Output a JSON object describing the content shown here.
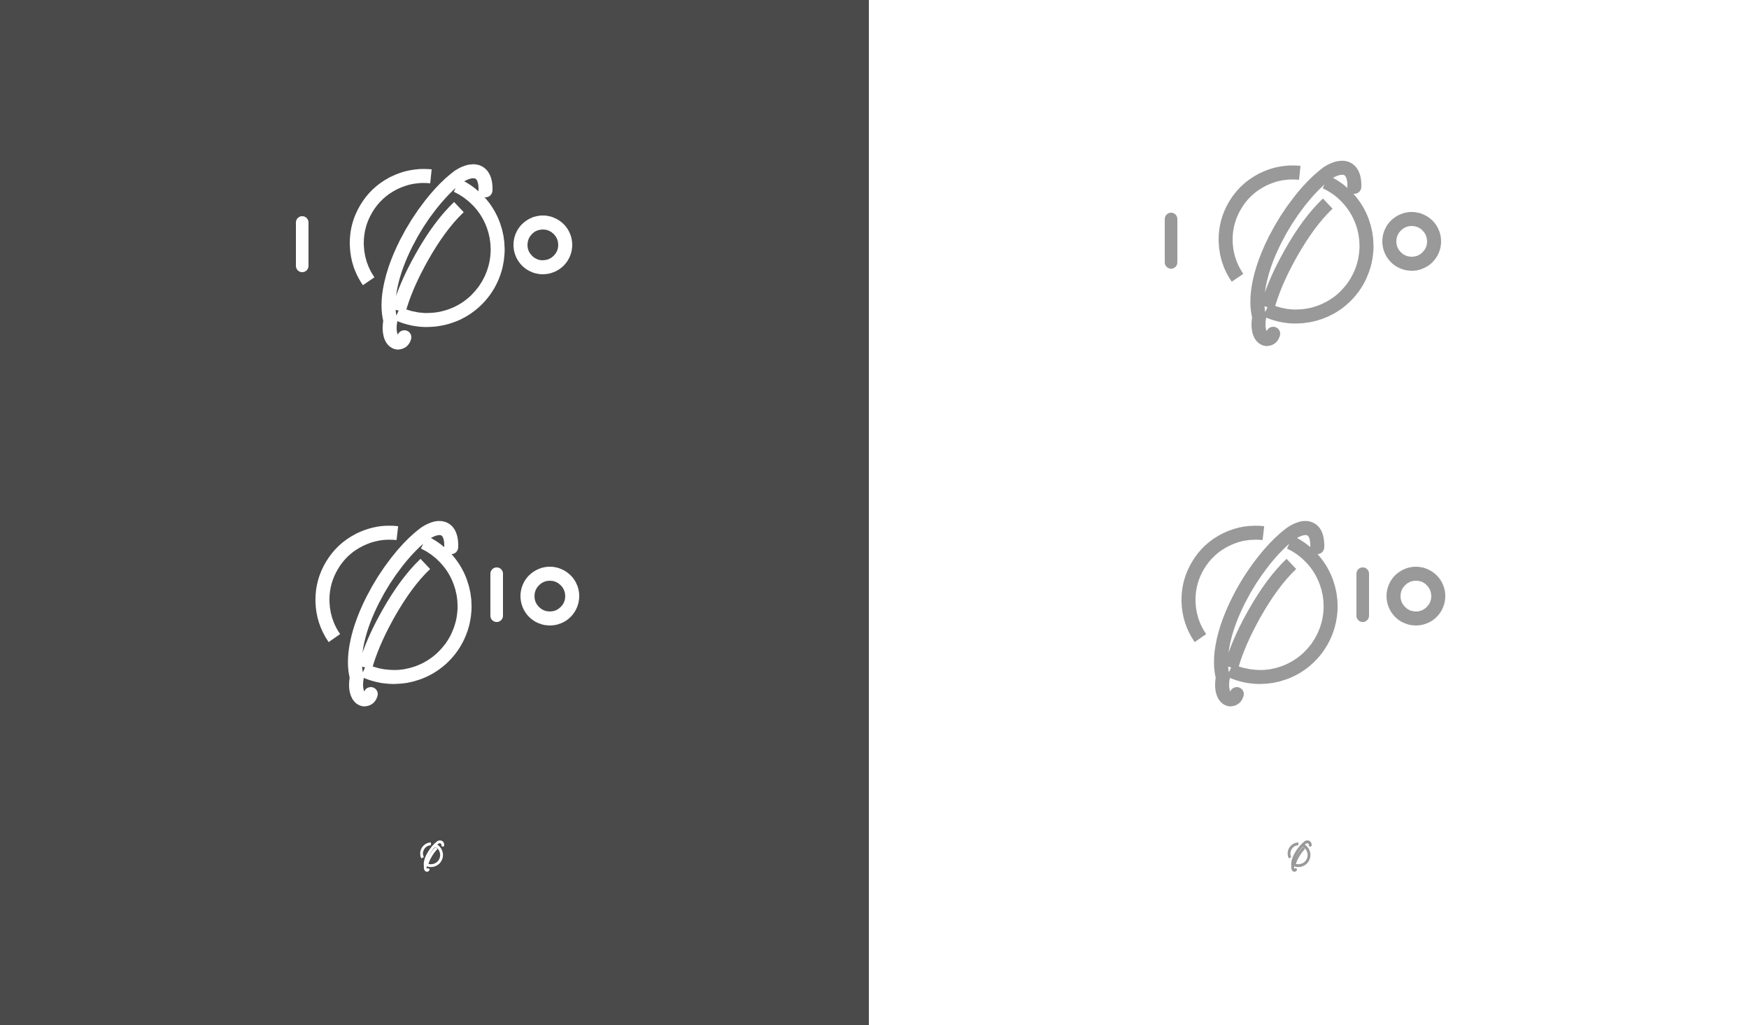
{
  "colors": {
    "dark_background": "#4a4a4a",
    "light_background": "#ffffff",
    "mark_on_dark": "#ffffff",
    "mark_on_light": "#999999"
  },
  "panels": [
    {
      "name": "dark-panel",
      "variants": [
        "horizontal-logo",
        "stacked-logo",
        "icon-only"
      ]
    },
    {
      "name": "light-panel",
      "variants": [
        "horizontal-logo",
        "stacked-logo",
        "icon-only"
      ]
    }
  ],
  "icons": [
    "leaf-ring-icon",
    "bar-glyph",
    "ring-glyph"
  ]
}
